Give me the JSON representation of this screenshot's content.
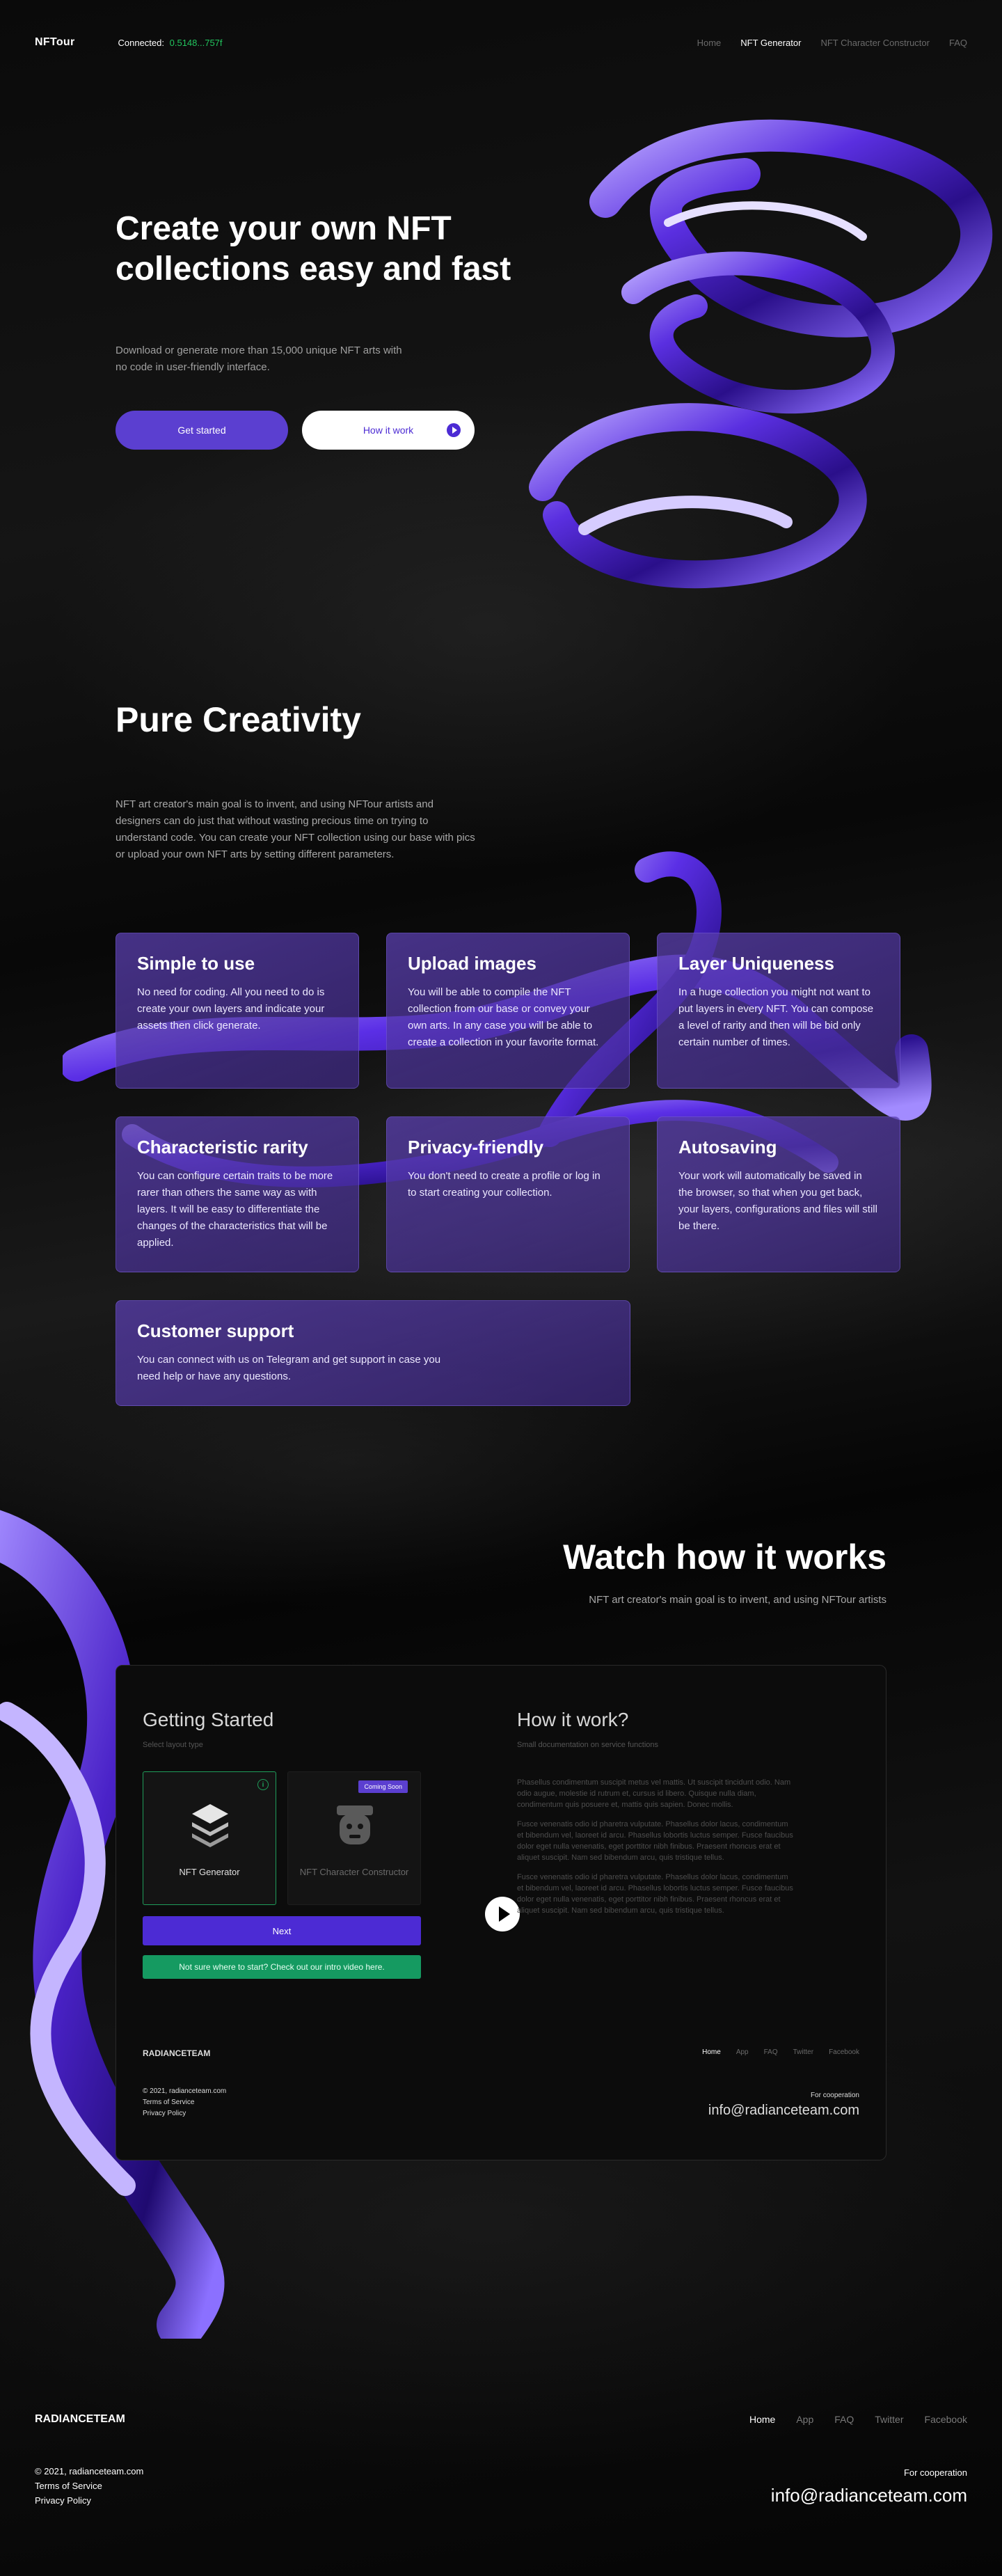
{
  "header": {
    "logo": "NFTour",
    "connected_label": "Connected:",
    "connected_address": "0.5148...757f",
    "nav": [
      "Home",
      "NFT Generator",
      "NFT Character Constructor",
      "FAQ"
    ],
    "active_nav": "NFT Generator"
  },
  "hero": {
    "title": "Create your own NFT collections easy and fast",
    "description": "Download or generate more than 15,000 unique NFT arts with no code in user-friendly interface.",
    "primary_button": "Get started",
    "secondary_button": "How it work"
  },
  "creativity": {
    "title": "Pure Creativity",
    "description": "NFT art creator's main goal is to invent, and using NFTour artists and designers can do just that without wasting precious time on trying to understand code. You can create your NFT collection using our base with pics or upload your own NFT arts by setting different parameters.",
    "features": [
      {
        "title": "Simple to use",
        "text": "No need for coding. All you need to do is create your own layers and indicate your assets then click generate."
      },
      {
        "title": "Upload images",
        "text": "You will be able to compile the NFT collection from our base or convey your own arts. In any case you will be able to create a collection in your favorite format."
      },
      {
        "title": "Layer Uniqueness",
        "text": "In a huge collection you might not want to put layers in every NFT. You can compose a level of rarity and then will be bid only certain number of times."
      },
      {
        "title": "Characteristic rarity",
        "text": "You can configure certain traits to be more rarer than others the same way as with layers. It will be easy to differentiate the changes of the characteristics that will be applied."
      },
      {
        "title": "Privacy-friendly",
        "text": "You don't need to create a profile or log in to start creating your collection."
      },
      {
        "title": "Autosaving",
        "text": "Your work will automatically be saved in the browser, so that when you get back, your layers, configurations and files will still be there."
      },
      {
        "title": "Customer support",
        "text": "You can connect with us on Telegram and get support in case you need help or have any questions."
      }
    ]
  },
  "watch": {
    "title": "Watch how it works",
    "subtitle": "NFT art creator's main goal is to invent, and using NFTour artists"
  },
  "preview": {
    "gs_title": "Getting Started",
    "gs_sub": "Select layout type",
    "option1": "NFT Generator",
    "option2": "NFT Character Constructor",
    "coming_soon": "Coming Soon",
    "next": "Next",
    "help": "Not sure where to start? Check out our intro video here.",
    "hw_title": "How it work?",
    "hw_sub": "Small documentation on service functions",
    "paragraphs": [
      "Phasellus condimentum suscipit metus vel mattis. Ut suscipit tincidunt odio. Nam odio augue, molestie id rutrum et, cursus id libero. Quisque nulla diam, condimentum quis posuere et, mattis quis sapien. Donec mollis.",
      "Fusce venenatis odio id pharetra vulputate. Phasellus dolor lacus, condimentum et bibendum vel, laoreet id arcu. Phasellus lobortis luctus semper. Fusce faucibus dolor eget nulla venenatis, eget porttitor nibh finibus. Praesent rhoncus erat et aliquet suscipit. Nam sed bibendum arcu, quis tristique tellus.",
      "Fusce venenatis odio id pharetra vulputate. Phasellus dolor lacus, condimentum et bibendum vel, laoreet id arcu. Phasellus lobortis luctus semper. Fusce faucibus dolor eget nulla venenatis, eget porttitor nibh finibus. Praesent rhoncus erat et aliquet suscipit. Nam sed bibendum arcu, quis tristique tellus."
    ],
    "footer_logo": "RADIANCETEAM",
    "footer_nav": [
      "Home",
      "App",
      "FAQ",
      "Twitter",
      "Facebook"
    ],
    "legal": [
      "© 2021, radianceteam.com",
      "Terms of Service",
      "Privacy Policy"
    ],
    "coop": "For cooperation",
    "email": "info@radianceteam.com"
  },
  "footer": {
    "logo": "RADIANCETEAM",
    "nav": [
      "Home",
      "App",
      "FAQ",
      "Twitter",
      "Facebook"
    ],
    "active_nav": "Home",
    "legal": [
      "© 2021, radianceteam.com",
      "Terms of Service",
      "Privacy Policy"
    ],
    "coop": "For cooperation",
    "email": "info@radianceteam.com"
  },
  "colors": {
    "accent": "#5b3fd0",
    "connected": "#22c55e",
    "green_button": "#159a61",
    "background": "#000000"
  }
}
